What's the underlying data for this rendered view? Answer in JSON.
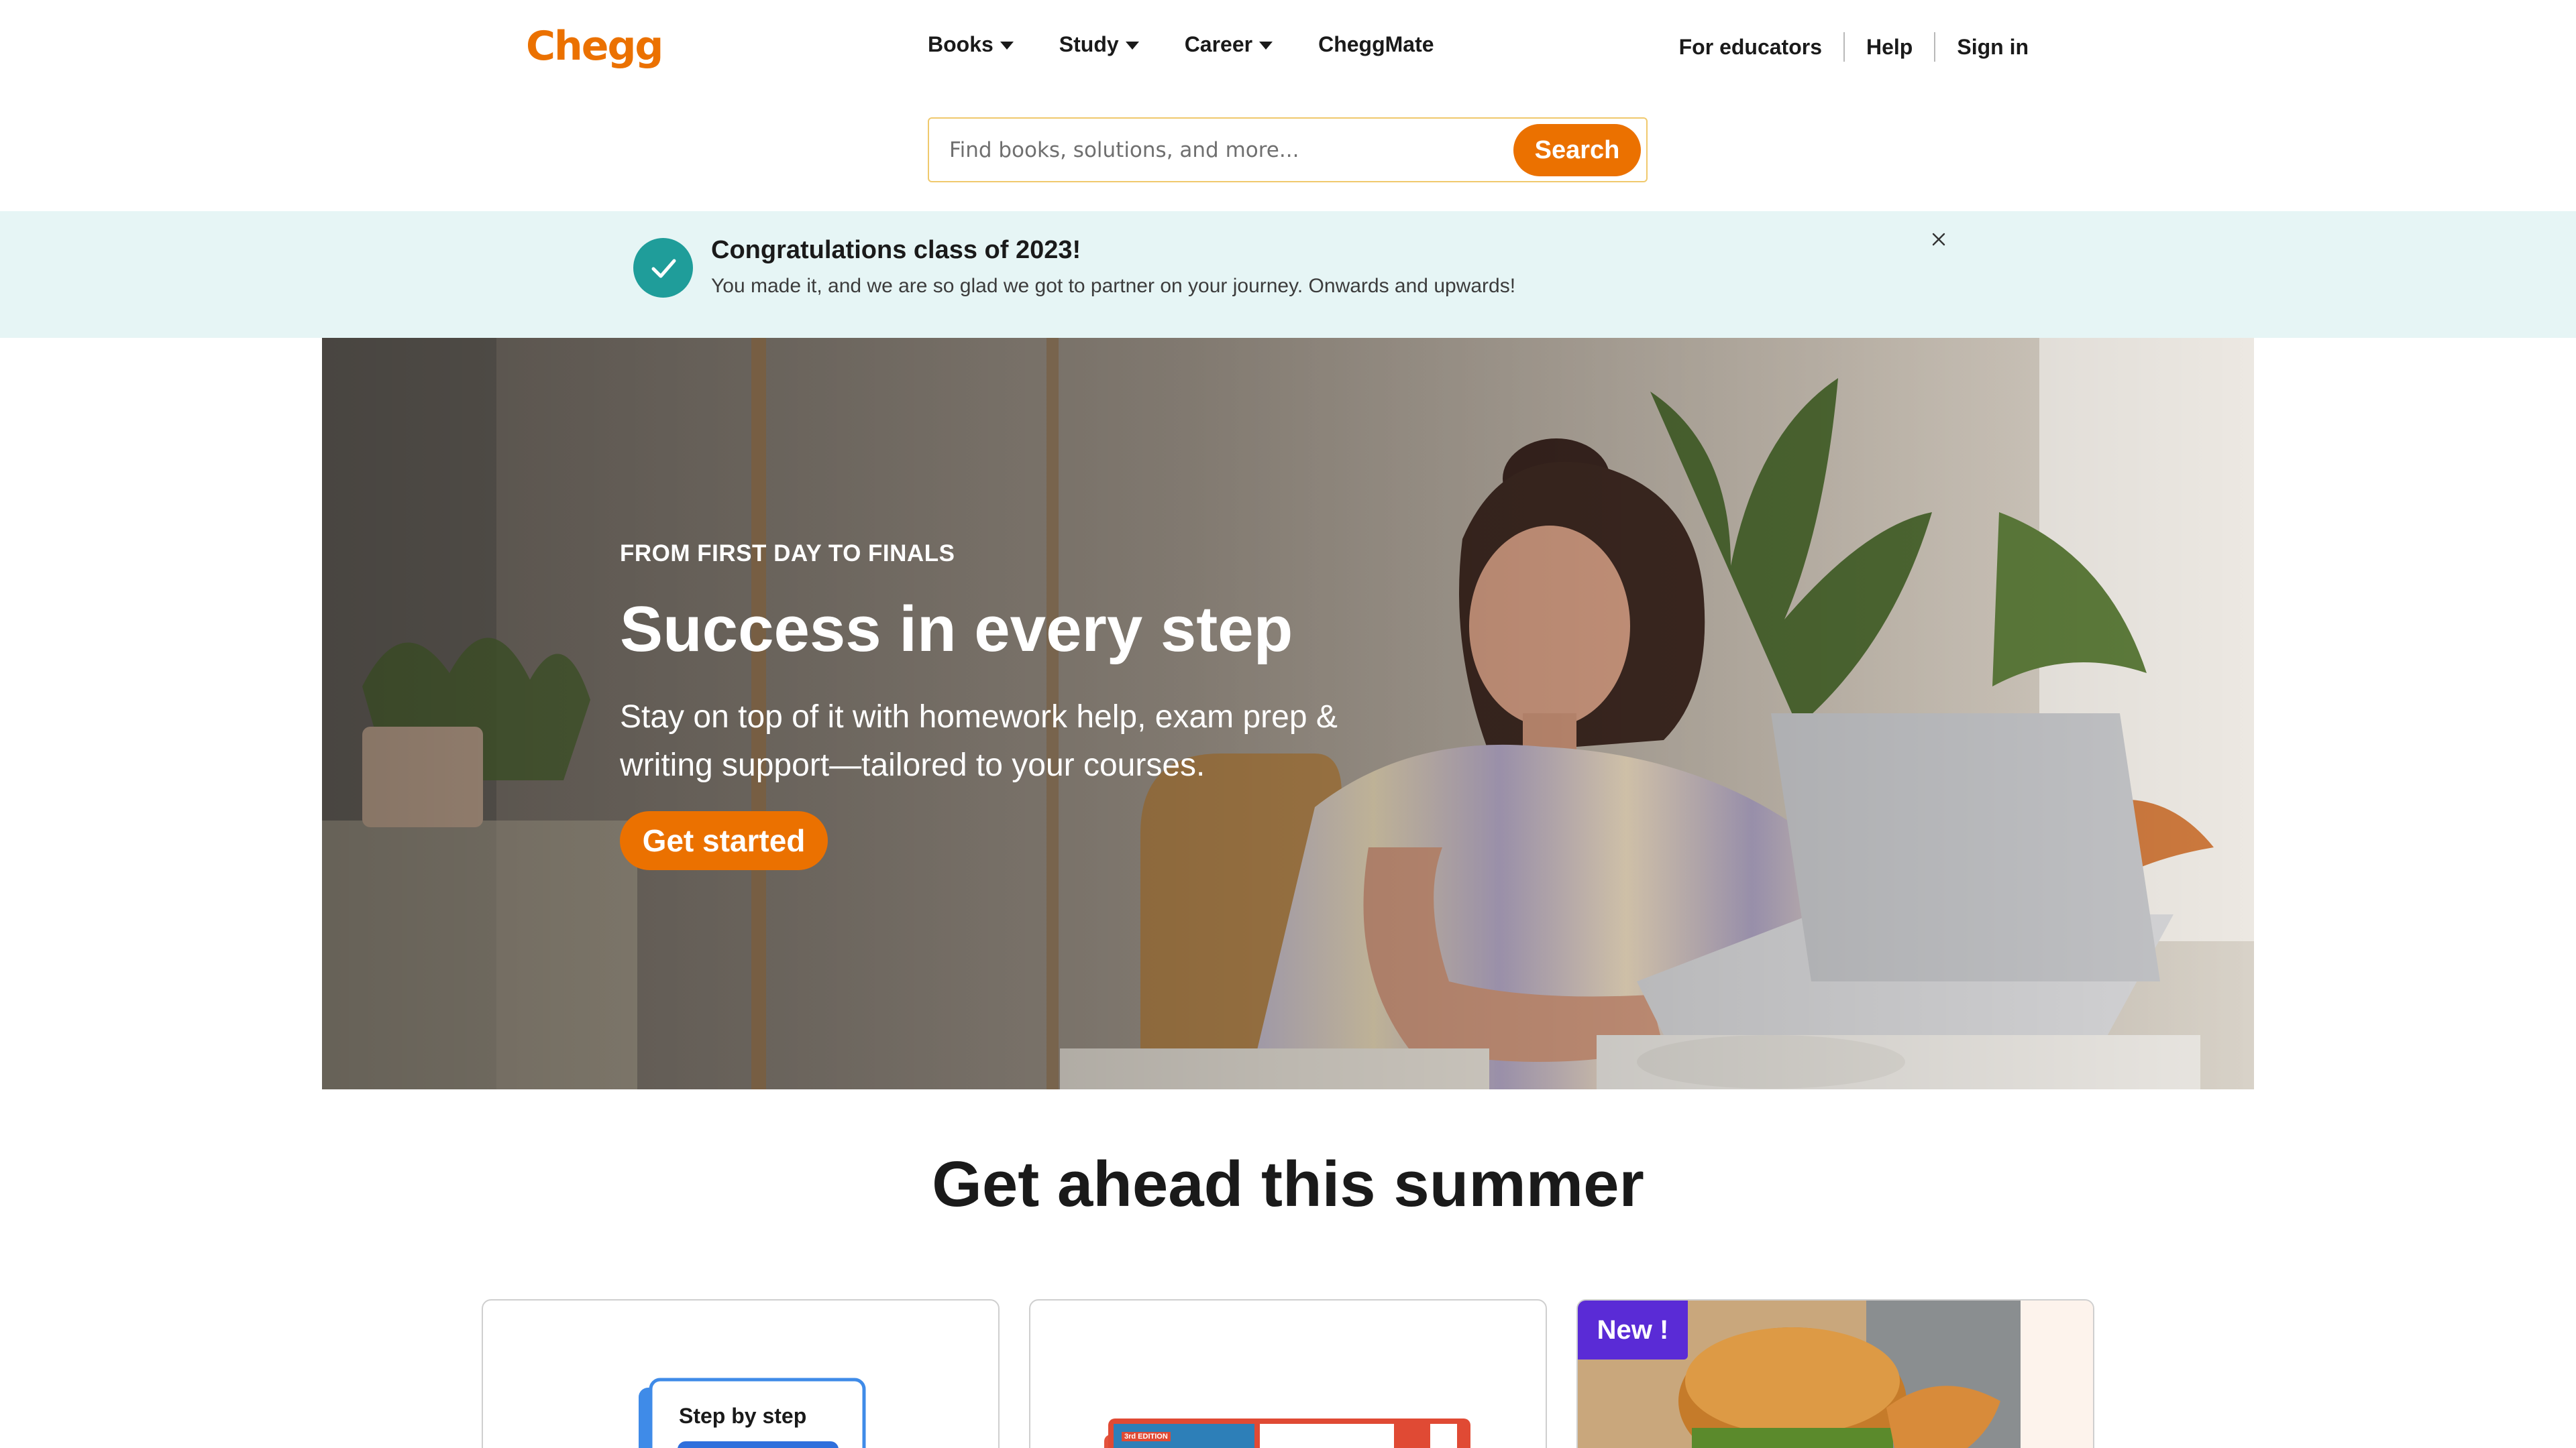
{
  "header": {
    "logo": "Chegg",
    "nav": [
      {
        "label": "Books",
        "dropdown": true
      },
      {
        "label": "Study",
        "dropdown": true
      },
      {
        "label": "Career",
        "dropdown": true
      },
      {
        "label": "CheggMate",
        "dropdown": false
      }
    ],
    "utility": [
      "For educators",
      "Help",
      "Sign in"
    ],
    "search": {
      "placeholder": "Find books, solutions, and more...",
      "button": "Search"
    }
  },
  "banner": {
    "title": "Congratulations class of 2023!",
    "text": "You made it, and we are so glad we got to partner on your journey. Onwards and upwards!",
    "close_icon": "close-icon",
    "status_icon": "checkmark-icon"
  },
  "hero": {
    "eyebrow": "FROM FIRST DAY TO FINALS",
    "title": "Success in every step",
    "subtitle": "Stay on top of it with homework help, exam prep & writing support—tailored to your courses.",
    "cta": "Get started"
  },
  "section": {
    "title": "Get ahead this summer",
    "cards": [
      {
        "image_text": "Step by step"
      },
      {
        "image_text": "3rd EDITION"
      },
      {
        "badge": "New !"
      }
    ]
  },
  "colors": {
    "brand": "#eb7100",
    "banner_bg": "#e6f5f5",
    "check": "#1f9d9a",
    "badge": "#5a2bd6"
  }
}
